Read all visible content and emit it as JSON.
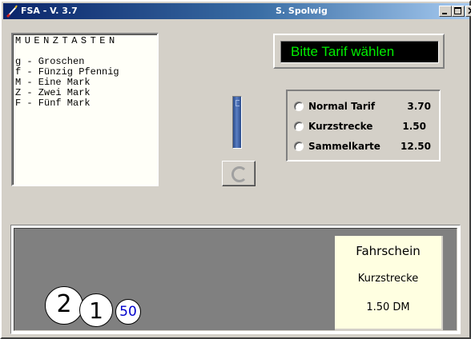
{
  "window": {
    "title": "FSA - V. 3.7",
    "author": "S. Spolwig",
    "icon": "brush-icon",
    "controls": [
      "minimize-icon",
      "maximize-icon",
      "close-icon"
    ]
  },
  "info_panel": {
    "heading": "MUENZTASTEN",
    "lines": [
      "g - Groschen",
      "f - Fünzig Pfennig",
      "M - Eine Mark",
      "Z - Zwei Mark",
      "F - Fünf Mark"
    ]
  },
  "display": {
    "text": "Bitte Tarif wählen",
    "text_color": "#00ee00",
    "background": "#000000"
  },
  "coin_slot": {
    "icon": "coin-slot-icon"
  },
  "refund_button": {
    "icon": "refund-c-icon"
  },
  "tariffs": [
    {
      "name": "Normal Tarif",
      "price": "3.70",
      "selected": false
    },
    {
      "name": "Kurzstrecke",
      "price": "1.50",
      "selected": false
    },
    {
      "name": "Sammelkarte",
      "price": "12.50",
      "selected": false
    }
  ],
  "ticket": {
    "title": "Fahrschein",
    "tariff": "Kurzstrecke",
    "price": "1.50 DM",
    "background": "#ffffe1"
  },
  "coins": [
    "2",
    "1",
    "50"
  ]
}
